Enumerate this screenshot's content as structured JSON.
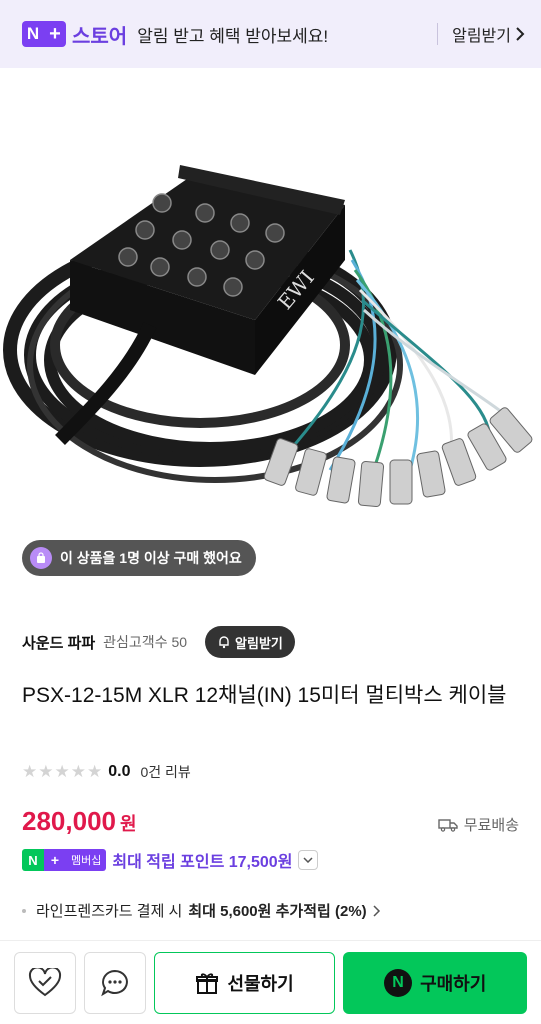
{
  "banner": {
    "logo_n": "N",
    "logo_plus": "+",
    "store_label": "스토어",
    "message": "알림 받고 혜택 받아보세요!",
    "link_label": "알림받기",
    "link_icon": "chevron-right-icon"
  },
  "buyer_badge": {
    "text": "이 상품을 1명 이상 구매 했어요",
    "icon": "shopping-bag-icon"
  },
  "seller": {
    "name": "사운드 파파",
    "interest_label": "관심고객수 50",
    "alarm_label": "알림받기"
  },
  "product": {
    "title": "PSX-12-15M XLR 12채널(IN) 15미터 멀티박스 케이블",
    "rating": "0.0",
    "rating_stars": 0,
    "reviews": "0건 리뷰",
    "price": "280,000",
    "currency": "원",
    "shipping": "무료배송"
  },
  "membership": {
    "badge_n": "N",
    "badge_plus": "+",
    "badge_label": "멤버십",
    "text": "최대 적립 포인트 17,500원"
  },
  "card_benefit": {
    "prefix": "라인프렌즈카드 결제 시",
    "strong": "최대 5,600원 추가적립 (2%)"
  },
  "bottom_bar": {
    "gift_label": "선물하기",
    "buy_n": "N",
    "buy_label": "구매하기"
  },
  "colors": {
    "accent_purple": "#7b3ff2",
    "naver_green": "#03c75a",
    "price_red": "#e0194b"
  }
}
